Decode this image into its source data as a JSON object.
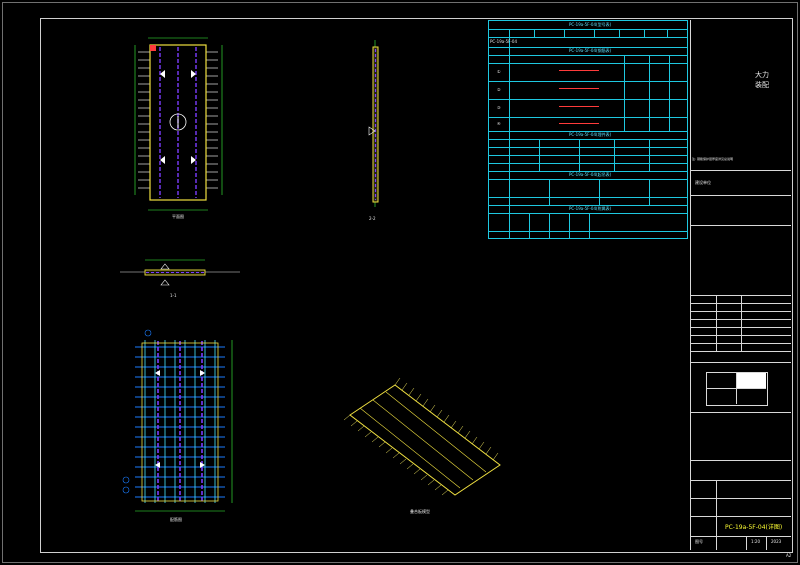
{
  "drawing": {
    "sheet_no": "A2",
    "views": {
      "plan_label": "平面图",
      "section_11": "1-1",
      "section_22": "2-2",
      "rebar_label": "配筋图",
      "iso_label": "叠合板模型"
    }
  },
  "tables": {
    "t1_title": "PC-19a-5F-04(型号表)",
    "t2_title": "PC-19a-5F-04(钢筋表)",
    "t3_title": "PC-19a-5F-04(埋件表)",
    "t4_title": "PC-19a-5F-04(起吊表)",
    "t5_title": "PC-19a-5F-04(附属表)",
    "model_no": "PC-19a-5F-04",
    "row_codes": [
      "①",
      "②",
      "③",
      "④"
    ],
    "note_text": "注: 钢筋保护层厚度详见总说明"
  },
  "title_block": {
    "company": "大力装配",
    "project_label": "建设单位",
    "drawing_name": "PC-19a-5F-04(详图)",
    "sheet_label": "图号",
    "scale": "1:20",
    "date": "2023"
  },
  "colors": {
    "frame": "#d0d0d0",
    "table": "#1ec8e0",
    "rebar_blue": "#1a7cff",
    "rebar_cyan": "#48e6ff",
    "concrete_yellow": "#f0e040",
    "truss_purple": "#7b3cff",
    "marker_white": "#ffffff",
    "dim_green": "#3cff3c",
    "title_yellow": "#ffff33"
  }
}
